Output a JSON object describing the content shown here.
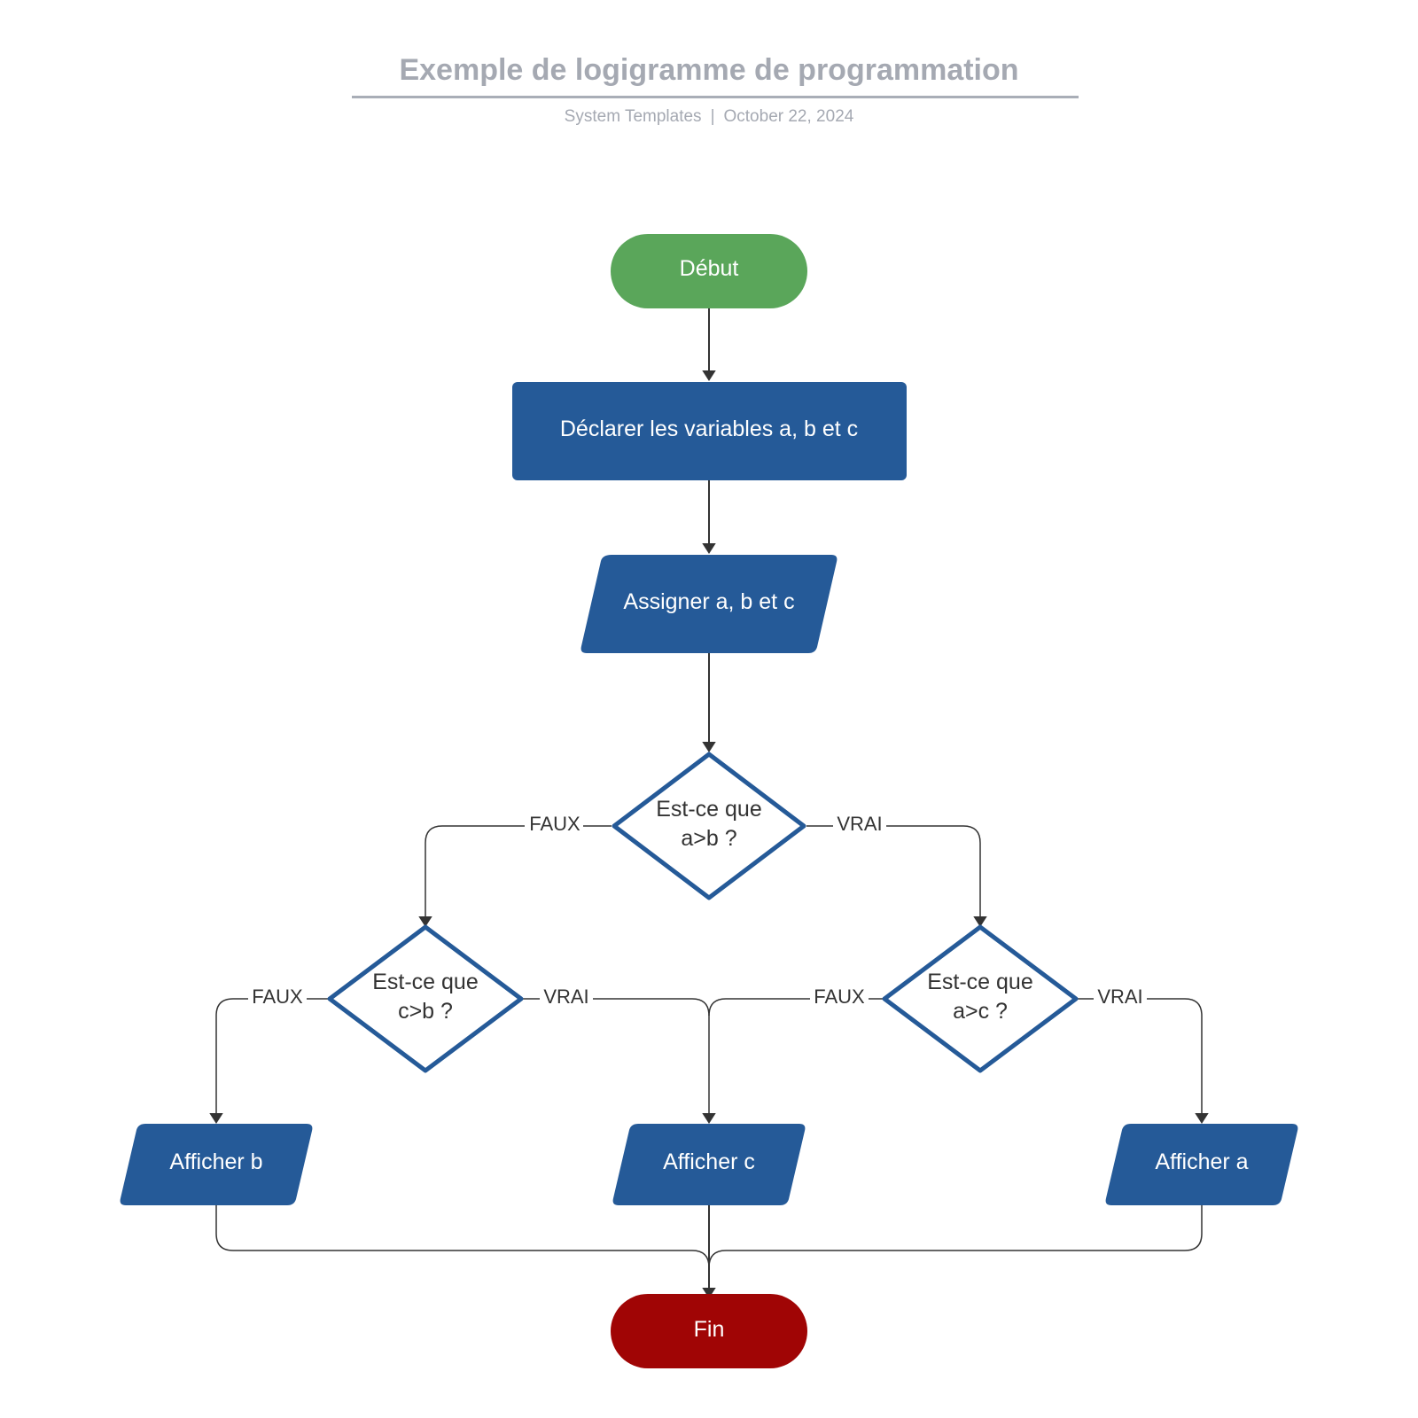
{
  "header": {
    "title": "Exemple de logigramme de programmation",
    "author": "System Templates",
    "separator": "|",
    "date": "October 22, 2024"
  },
  "colors": {
    "start": "#5aa65a",
    "end": "#a00505",
    "process": "#255a98",
    "decision_stroke": "#255a98",
    "connector": "#333333",
    "title": "#a5a9b2"
  },
  "nodes": {
    "start": {
      "label": "Début",
      "shape": "terminator"
    },
    "declare": {
      "label": "Déclarer les variables a, b et c",
      "shape": "process"
    },
    "assign": {
      "label": "Assigner a, b et c",
      "shape": "data"
    },
    "d1": {
      "line1": "Est-ce que",
      "line2": "a>b ?",
      "shape": "decision"
    },
    "d2": {
      "line1": "Est-ce que",
      "line2": "c>b ?",
      "shape": "decision"
    },
    "d3": {
      "line1": "Est-ce que",
      "line2": "a>c ?",
      "shape": "decision"
    },
    "show_b": {
      "label": "Afficher b",
      "shape": "data"
    },
    "show_c": {
      "label": "Afficher c",
      "shape": "data"
    },
    "show_a": {
      "label": "Afficher a",
      "shape": "data"
    },
    "end": {
      "label": "Fin",
      "shape": "terminator"
    }
  },
  "edges": [
    {
      "from": "start",
      "to": "declare",
      "label": ""
    },
    {
      "from": "declare",
      "to": "assign",
      "label": ""
    },
    {
      "from": "assign",
      "to": "d1",
      "label": ""
    },
    {
      "from": "d1",
      "to": "d2",
      "label": "FAUX"
    },
    {
      "from": "d1",
      "to": "d3",
      "label": "VRAI"
    },
    {
      "from": "d2",
      "to": "show_b",
      "label": "FAUX"
    },
    {
      "from": "d2",
      "to": "show_c",
      "label": "VRAI"
    },
    {
      "from": "d3",
      "to": "show_c",
      "label": "FAUX"
    },
    {
      "from": "d3",
      "to": "show_a",
      "label": "VRAI"
    },
    {
      "from": "show_b",
      "to": "end",
      "label": ""
    },
    {
      "from": "show_c",
      "to": "end",
      "label": ""
    },
    {
      "from": "show_a",
      "to": "end",
      "label": ""
    }
  ],
  "edge_labels": {
    "d1_false": "FAUX",
    "d1_true": "VRAI",
    "d2_false": "FAUX",
    "d2_true": "VRAI",
    "d3_false": "FAUX",
    "d3_true": "VRAI"
  }
}
